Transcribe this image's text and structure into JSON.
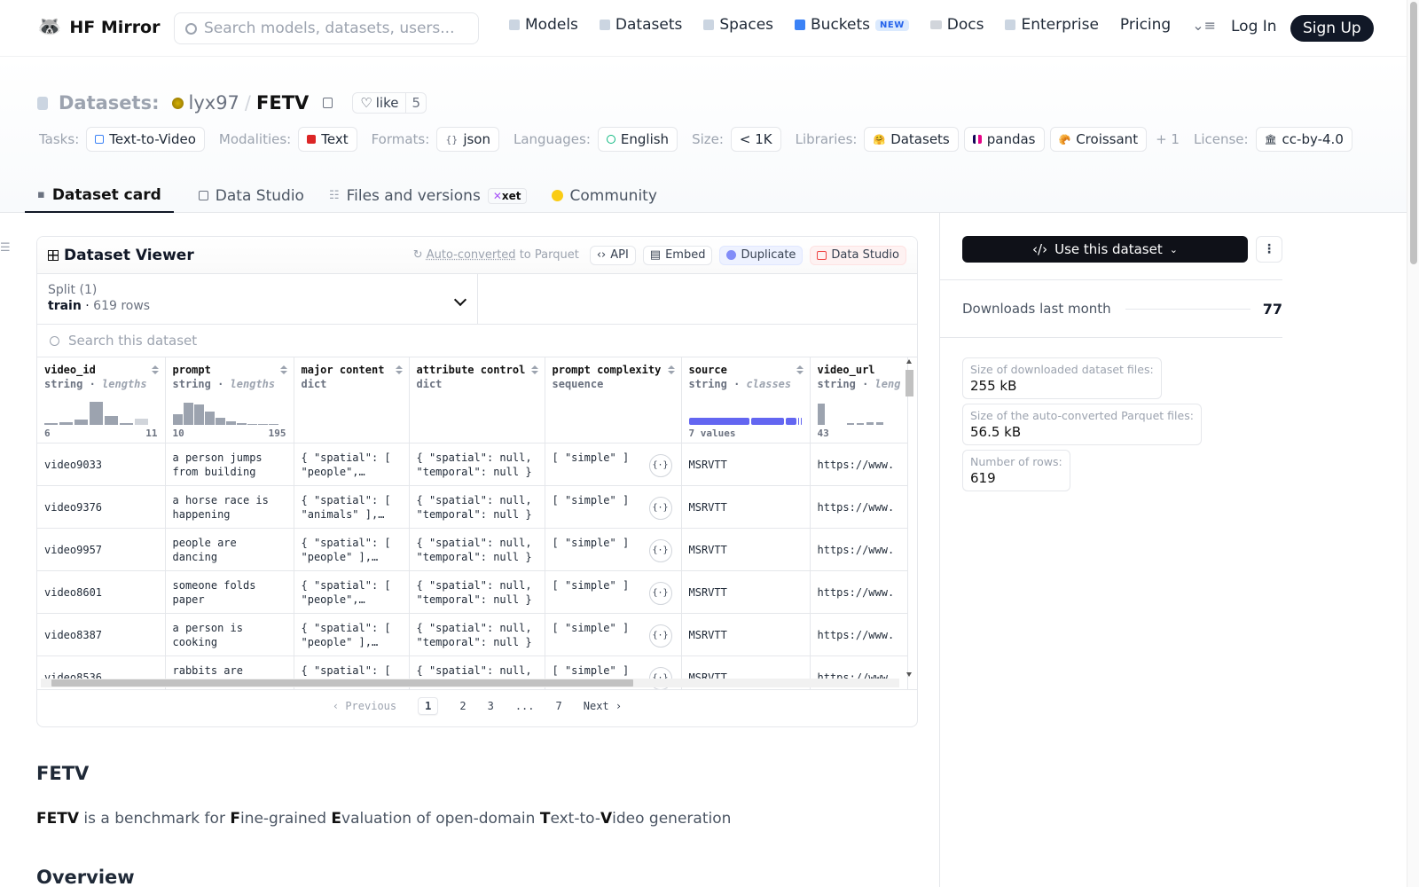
{
  "header": {
    "brand": "HF Mirror",
    "search_placeholder": "Search models, datasets, users...",
    "nav": [
      {
        "label": "Models",
        "icon": "cube-icon"
      },
      {
        "label": "Datasets",
        "icon": "database-icon"
      },
      {
        "label": "Spaces",
        "icon": "grid-icon"
      },
      {
        "label": "Buckets",
        "icon": "bucket-icon",
        "badge": "NEW"
      },
      {
        "label": "Docs",
        "icon": "book-icon"
      },
      {
        "label": "Enterprise",
        "icon": "enterprise-icon"
      },
      {
        "label": "Pricing"
      }
    ],
    "login": "Log In",
    "signup": "Sign Up"
  },
  "repo": {
    "kind": "Datasets:",
    "user": "lyx97",
    "sep": "/",
    "name": "FETV",
    "like_label": "like",
    "likes": "5"
  },
  "tags": {
    "tasks_key": "Tasks:",
    "tasks": "Text-to-Video",
    "modalities_key": "Modalities:",
    "modalities": "Text",
    "formats_key": "Formats:",
    "formats": "json",
    "languages_key": "Languages:",
    "languages": "English",
    "size_key": "Size:",
    "size": "< 1K",
    "libraries_key": "Libraries:",
    "libraries": [
      "Datasets",
      "pandas",
      "Croissant"
    ],
    "libraries_more": "+ 1",
    "license_key": "License:",
    "license": "cc-by-4.0"
  },
  "tabs": [
    {
      "label": "Dataset card"
    },
    {
      "label": "Data Studio"
    },
    {
      "label": "Files and versions",
      "badge": "xet"
    },
    {
      "label": "Community"
    }
  ],
  "viewer": {
    "title": "Dataset Viewer",
    "auto_a": "Auto-converted",
    "auto_b": " to Parquet",
    "api": "API",
    "embed": "Embed",
    "duplicate": "Duplicate",
    "data_studio": "Data Studio",
    "split_label": "Split (1)",
    "split_name": "train",
    "split_rows": "619 rows",
    "search_placeholder": "Search this dataset",
    "columns": [
      {
        "name": "video_id",
        "type": "string",
        "sub": "lengths",
        "min": "6",
        "max": "11"
      },
      {
        "name": "prompt",
        "type": "string",
        "sub": "lengths",
        "min": "10",
        "max": "195"
      },
      {
        "name": "major content",
        "type": "dict"
      },
      {
        "name": "attribute control",
        "type": "dict"
      },
      {
        "name": "prompt complexity",
        "type": "sequence"
      },
      {
        "name": "source",
        "type": "string",
        "sub": "classes",
        "values_note": "7 values"
      },
      {
        "name": "video_url",
        "type": "string",
        "sub": "leng",
        "min": "43"
      }
    ],
    "rows": [
      {
        "video_id": "video9033",
        "prompt": "a person jumps from building",
        "major": "{ \"spatial\": [ \"people\",…",
        "attr": "{ \"spatial\": null, \"temporal\": null }",
        "complexity": "[ \"simple\" ]",
        "source": "MSRVTT",
        "url": "https://www."
      },
      {
        "video_id": "video9376",
        "prompt": "a horse race is happening",
        "major": "{ \"spatial\": [ \"animals\" ],…",
        "attr": "{ \"spatial\": null, \"temporal\": null }",
        "complexity": "[ \"simple\" ]",
        "source": "MSRVTT",
        "url": "https://www."
      },
      {
        "video_id": "video9957",
        "prompt": "people are dancing",
        "major": "{ \"spatial\": [ \"people\" ],…",
        "attr": "{ \"spatial\": null, \"temporal\": null }",
        "complexity": "[ \"simple\" ]",
        "source": "MSRVTT",
        "url": "https://www."
      },
      {
        "video_id": "video8601",
        "prompt": "someone folds paper",
        "major": "{ \"spatial\": [ \"people\",…",
        "attr": "{ \"spatial\": null, \"temporal\": null }",
        "complexity": "[ \"simple\" ]",
        "source": "MSRVTT",
        "url": "https://www."
      },
      {
        "video_id": "video8387",
        "prompt": "a person is cooking",
        "major": "{ \"spatial\": [ \"people\" ],…",
        "attr": "{ \"spatial\": null, \"temporal\": null }",
        "complexity": "[ \"simple\" ]",
        "source": "MSRVTT",
        "url": "https://www."
      },
      {
        "video_id": "video8536",
        "prompt": "rabbits are",
        "major": "{ \"spatial\": [",
        "attr": "{ \"spatial\": null,",
        "complexity": "[ \"simple\" ]",
        "source": "MSRVTT",
        "url": "https://www."
      }
    ],
    "json_button": "{·}",
    "pager": {
      "prev": "Previous",
      "pages": [
        "1",
        "2",
        "3",
        "...",
        "7"
      ],
      "next": "Next"
    }
  },
  "sidebar": {
    "use_dataset": "Use this dataset",
    "downloads_label": "Downloads last month",
    "downloads": "77",
    "stats": [
      {
        "label": "Size of downloaded dataset files:",
        "value": "255 kB"
      },
      {
        "label": "Size of the auto-converted Parquet files:",
        "value": "56.5 kB"
      },
      {
        "label": "Number of rows:",
        "value": "619"
      }
    ]
  },
  "card": {
    "heading": "FETV",
    "desc": [
      {
        "b": "FETV"
      },
      {
        "t": " is a benchmark for "
      },
      {
        "b": "F"
      },
      {
        "t": "ine-grained "
      },
      {
        "b": "E"
      },
      {
        "t": "valuation of open-domain "
      },
      {
        "b": "T"
      },
      {
        "t": "ext-to-"
      },
      {
        "b": "V"
      },
      {
        "t": "ideo generation"
      }
    ],
    "overview": "Overview"
  }
}
